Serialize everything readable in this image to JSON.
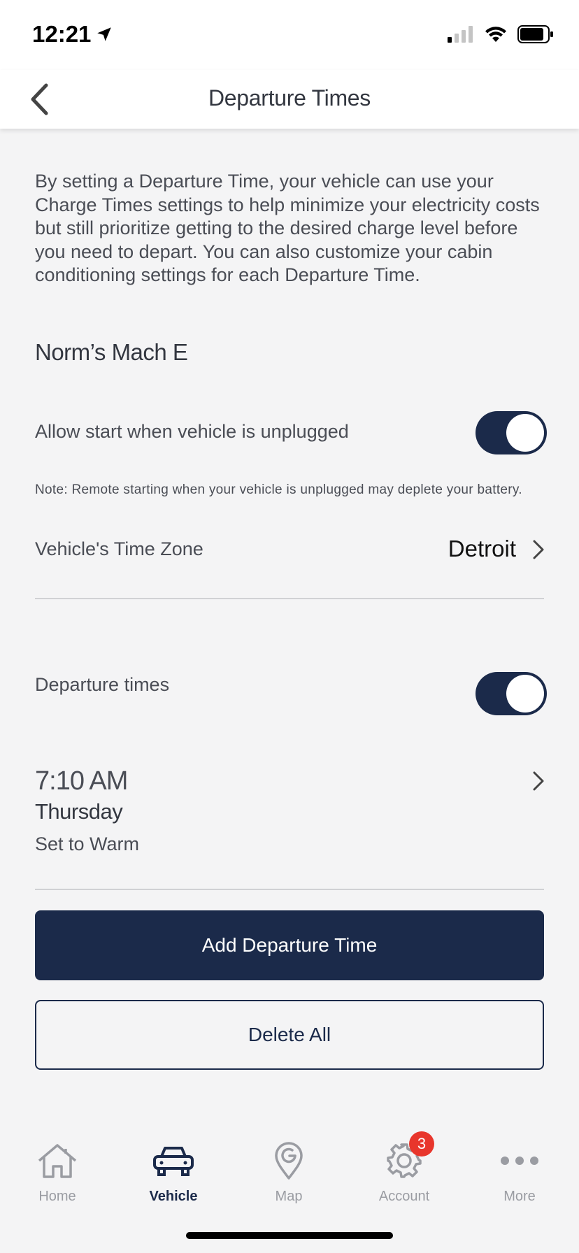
{
  "status": {
    "time": "12:21"
  },
  "header": {
    "title": "Departure Times"
  },
  "intro": "By setting a Departure Time, your vehicle can use your Charge Times settings to help minimize your electricity costs but still prioritize getting to the desired charge level before you need to depart. You can also customize your cabin conditioning settings for each Departure Time.",
  "vehicle_name": "Norm’s Mach E",
  "unplugged": {
    "label": "Allow start when vehicle is unplugged",
    "enabled": true
  },
  "note": "Note: Remote starting when your vehicle is unplugged may deplete your battery.",
  "time_zone": {
    "label": "Vehicle's Time Zone",
    "value": "Detroit"
  },
  "departure_times": {
    "label": "Departure times",
    "enabled": true,
    "items": [
      {
        "time": "7:10 AM",
        "day": "Thursday",
        "mode": "Set to Warm"
      }
    ]
  },
  "buttons": {
    "add": "Add Departure Time",
    "delete_all": "Delete All"
  },
  "tabs": [
    {
      "label": "Home",
      "icon": "home-icon"
    },
    {
      "label": "Vehicle",
      "icon": "car-icon",
      "active": true
    },
    {
      "label": "Map",
      "icon": "map-pin-icon"
    },
    {
      "label": "Account",
      "icon": "gear-icon",
      "badge": "3"
    },
    {
      "label": "More",
      "icon": "more-dots-icon"
    }
  ],
  "colors": {
    "accent": "#1b2a4a",
    "badge": "#e8362c",
    "background": "#f4f4f5"
  }
}
